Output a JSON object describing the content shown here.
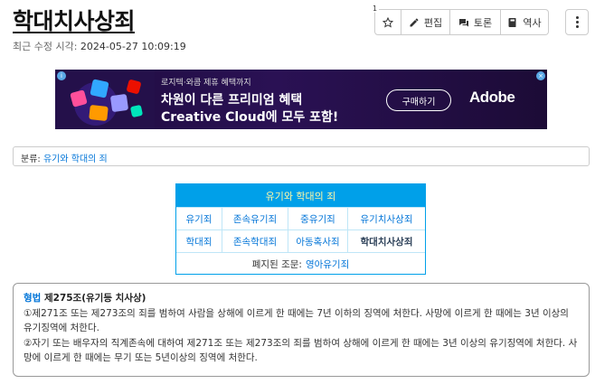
{
  "page": {
    "title": "학대치사상죄",
    "modified_label": "최근 수정 시각:",
    "modified_time": "2024-05-27 10:09:19"
  },
  "toolbar": {
    "star_count": "1",
    "edit_label": "편집",
    "discuss_label": "토론",
    "history_label": "역사",
    "icons": [
      "star-icon",
      "edit-icon",
      "chat-icon",
      "book-icon",
      "more-vertical-icon"
    ]
  },
  "ad": {
    "pre": "로지텍·와콤 제휴 혜택까지",
    "line1": "차원이 다른 프리미엄 혜택",
    "line2": "Creative Cloud에 모두 포함!",
    "button": "구매하기",
    "brand": "Adobe"
  },
  "category": {
    "label": "분류:",
    "link": "유기와 학대의 죄"
  },
  "navbox": {
    "title": "유기와 학대의 죄",
    "rows": [
      [
        "유기죄",
        "존속유기죄",
        "중유기죄",
        "유기치사상죄"
      ],
      [
        "학대죄",
        "존속학대죄",
        "아동혹사죄",
        "학대치사상죄"
      ]
    ],
    "footer_label": "폐지된 조문:",
    "footer_link": "영아유기죄"
  },
  "law": {
    "name": "형법",
    "article": "제275조(유기등 치사상)",
    "paragraph1": "①제271조 또는 제273조의 죄를 범하여 사람을 상해에 이르게 한 때에는 7년 이하의 징역에 처한다. 사망에 이르게 한 때에는 3년 이상의 유기징역에 처한다.",
    "paragraph2": "②자기 또는 배우자의 직계존속에 대하여 제271조 또는 제273조의 죄를 범하여 상해에 이르게 한 때에는 3년 이상의 유기징역에 처한다. 사망에 이르게 한 때에는 무기 또는 5년이상의 징역에 처한다."
  },
  "colors": {
    "link": "#0275d8",
    "navbox_header": "#00a0e9",
    "navbox_title_text": "#fff7a8",
    "ad_background": "#2a1154"
  }
}
